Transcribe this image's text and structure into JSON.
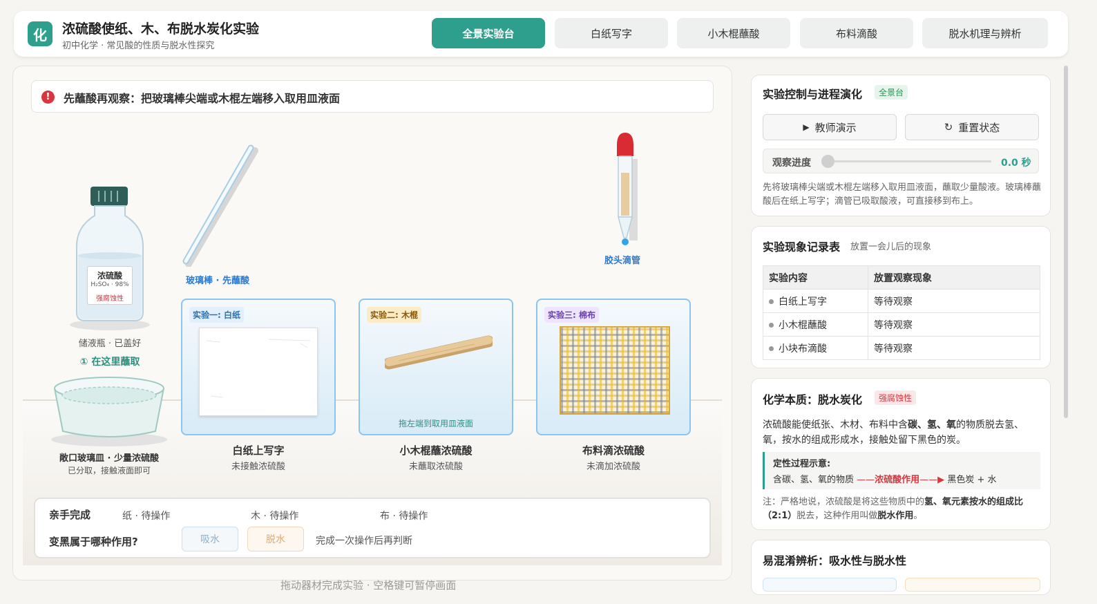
{
  "header": {
    "logo_char": "化",
    "title": "浓硫酸使纸、木、布脱水炭化实验",
    "subtitle": "初中化学 · 常见酸的性质与脱水性探究",
    "tabs": [
      {
        "label": "全景实验台",
        "active": true
      },
      {
        "label": "白纸写字",
        "active": false
      },
      {
        "label": "小木棍蘸酸",
        "active": false
      },
      {
        "label": "布料滴酸",
        "active": false
      },
      {
        "label": "脱水机理与辨析",
        "active": false
      }
    ]
  },
  "alert": {
    "icon": "exclamation-icon",
    "text": "先蘸酸再观察：把玻璃棒尖端或木棍左端移入取用皿液面"
  },
  "bench": {
    "bottle": {
      "label_name": "浓硫酸",
      "formula": "H₂SO₄ · 98%",
      "warning": "强腐蚀性",
      "caption": "储液瓶 · 已盖好",
      "hint": "① 在这里蘸取"
    },
    "dish": {
      "caption": "敞口玻璃皿 · 少量浓硫酸",
      "sub": "已分取，接触液面即可"
    },
    "glass_rod": {
      "caption": "玻璃棒 · 先蘸酸"
    },
    "dropper": {
      "caption": "胶头滴管"
    },
    "cards": [
      {
        "tag": "实验一: 白纸",
        "title": "白纸上写字",
        "status": "未接触浓硫酸",
        "hint": ""
      },
      {
        "tag": "实验二: 木棍",
        "title": "小木棍蘸浓硫酸",
        "status": "未蘸取浓硫酸",
        "hint": "拖左端到取用皿液面"
      },
      {
        "tag": "实验三: 棉布",
        "title": "布料滴浓硫酸",
        "status": "未滴加浓硫酸",
        "hint": ""
      }
    ],
    "bottom": {
      "label_do": "亲手完成",
      "status_paper": "纸 · 待操作",
      "status_wood": "木 · 待操作",
      "status_cloth": "布 · 待操作",
      "question": "变黑属于哪种作用?",
      "choice_absorb": "吸水",
      "choice_dehydrate": "脱水",
      "choice_hint": "完成一次操作后再判断"
    },
    "footer_hint": "拖动器材完成实验 · 空格键可暂停画面"
  },
  "control": {
    "title": "实验控制与进程演化",
    "badge": "全景台",
    "demo_label": "教师演示",
    "reset_label": "重置状态",
    "progress_label": "观察进度",
    "progress_value": "0.0 秒",
    "progress_fraction": 0,
    "description": "先将玻璃棒尖端或木棍左端移入取用皿液面，蘸取少量酸液。玻璃棒蘸酸后在纸上写字；滴管已吸取酸液，可直接移到布上。"
  },
  "record": {
    "title": "实验现象记录表",
    "subtitle": "放置一会儿后的现象",
    "headers": [
      "实验内容",
      "放置观察现象"
    ],
    "rows": [
      {
        "item": "白纸上写字",
        "result": "等待观察"
      },
      {
        "item": "小木棍蘸酸",
        "result": "等待观察"
      },
      {
        "item": "小块布滴酸",
        "result": "等待观察"
      }
    ]
  },
  "essence": {
    "title": "化学本质：脱水炭化",
    "badge": "强腐蚀性",
    "desc_1": "浓硫酸能使纸张、木材、布料中含",
    "desc_b1": "碳、氢、氧",
    "desc_2": "的物质脱去氢、氧，按水的组成形成水，接触处留下黑色的炭。",
    "process_title": "定性过程示意:",
    "process_from": "含碳、氢、氧的物质",
    "process_agent": "浓硫酸作用",
    "process_to": "黑色炭 + 水",
    "note_1": "注：严格地说，浓硫酸是将这些物质中的",
    "note_b1": "氢、氧元素按水的组成比（2:1）",
    "note_2": "脱去，这种作用叫做",
    "note_b2": "脱水作用",
    "note_3": "。"
  },
  "confuse": {
    "title": "易混淆辨析：吸水性与脱水性"
  },
  "colors": {
    "accent": "#2e9f8c",
    "danger": "#d9363e",
    "link": "#2a7bd0"
  }
}
